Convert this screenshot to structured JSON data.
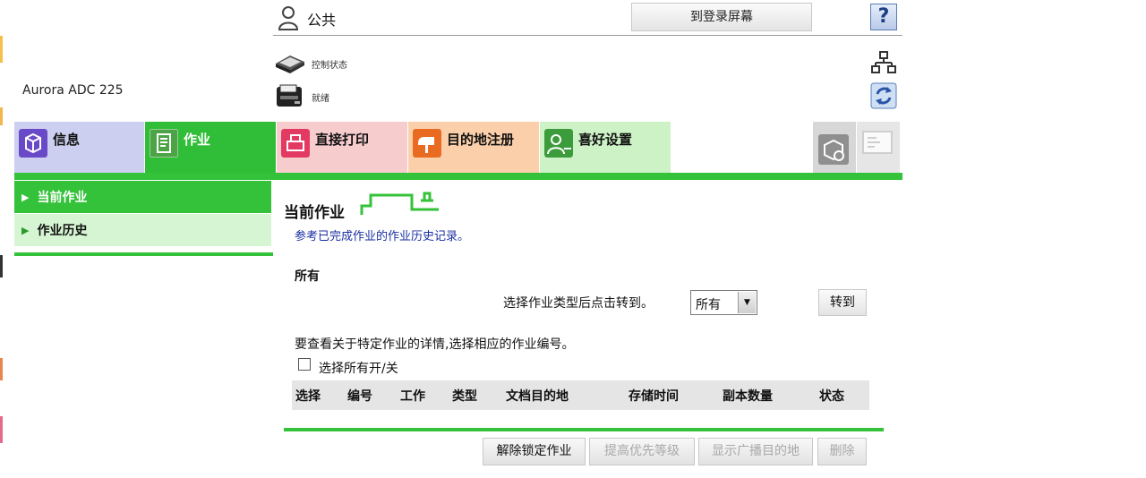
{
  "header": {
    "user_label": "公共",
    "login_button": "到登录屏幕",
    "help_button": "?",
    "status_items": [
      {
        "icon": "scanner-status-icon",
        "label": "控制状态"
      },
      {
        "icon": "printer-status-icon",
        "label": "就绪"
      }
    ],
    "device_name": "Aurora ADC 225",
    "side_icons": [
      "network-icon",
      "refresh-icon"
    ]
  },
  "tabs": [
    {
      "name": "tab-info",
      "label": "信息",
      "bg": "#cccff0",
      "icon_color": "#6a49c8"
    },
    {
      "name": "tab-job",
      "label": "作业",
      "bg": "#30bd38",
      "icon_color": "#4da446",
      "active": true
    },
    {
      "name": "tab-direct-print",
      "label": "直接打印",
      "bg": "#f7cccd",
      "icon_color": "#e23a62"
    },
    {
      "name": "tab-destination",
      "label": "目的地注册",
      "bg": "#fbcfa9",
      "icon_color": "#e96b22"
    },
    {
      "name": "tab-favorites",
      "label": "喜好设置",
      "bg": "#cdf2c6",
      "icon_color": "#3c9c3c"
    }
  ],
  "sidenav": {
    "items": [
      {
        "label": "当前作业",
        "active": true
      },
      {
        "label": "作业历史",
        "active": false
      }
    ]
  },
  "main": {
    "title": "当前作业",
    "subtitle": "参考已完成作业的作业历史记录。",
    "section": "所有",
    "select_hint": "选择作业类型后点击转到。",
    "select_value": "所有",
    "go_button": "转到",
    "detail_hint": "要查看关于特定作业的详情,选择相应的作业编号。",
    "select_all_label": "选择所有开/关",
    "table_headers": [
      "选择",
      "编号",
      "工作",
      "类型",
      "文档目的地",
      "存储时间",
      "副本数量",
      "状态"
    ],
    "actions": [
      {
        "label": "解除锁定作业",
        "enabled": true
      },
      {
        "label": "提高优先等级",
        "enabled": false
      },
      {
        "label": "显示广播目的地",
        "enabled": false
      },
      {
        "label": "删除",
        "enabled": false
      }
    ]
  },
  "colors": {
    "accent_green": "#34c23a",
    "link_blue": "#1a2fa0"
  }
}
